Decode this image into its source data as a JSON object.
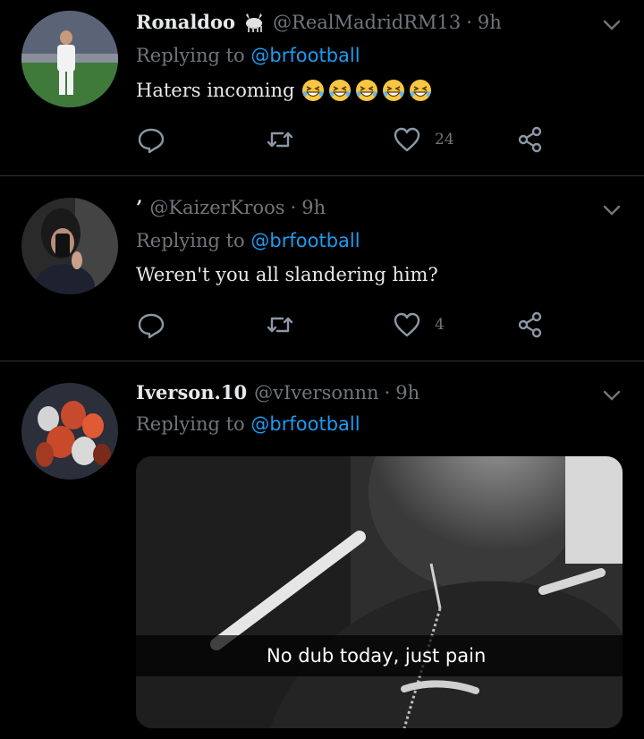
{
  "tweets": [
    {
      "name": "Ronaldoo",
      "badge_icon": "goat-icon",
      "handle": "@RealMadridRM13",
      "time": "9h",
      "reply_prefix": "Replying to",
      "reply_to": "@brfootball",
      "text": "Haters incoming",
      "emoji_icon": "grinning-squinting-face-icon",
      "emoji_count": 5,
      "reply_count": "",
      "retweet_count": "",
      "like_count": "24"
    },
    {
      "name": "’",
      "handle": "@KaizerKroos",
      "time": "9h",
      "reply_prefix": "Replying to",
      "reply_to": "@brfootball",
      "text": "Weren't you all slandering him?",
      "reply_count": "",
      "retweet_count": "",
      "like_count": "4"
    },
    {
      "name": "Iverson.10",
      "handle": "@vIversonnn",
      "time": "9h",
      "reply_prefix": "Replying to",
      "reply_to": "@brfootball",
      "media_caption": "No dub today, just pain"
    }
  ],
  "colors": {
    "background": "#000000",
    "text": "#e7e9ea",
    "muted": "#71767b",
    "link": "#1d9bf0",
    "divider": "#2f3336"
  }
}
